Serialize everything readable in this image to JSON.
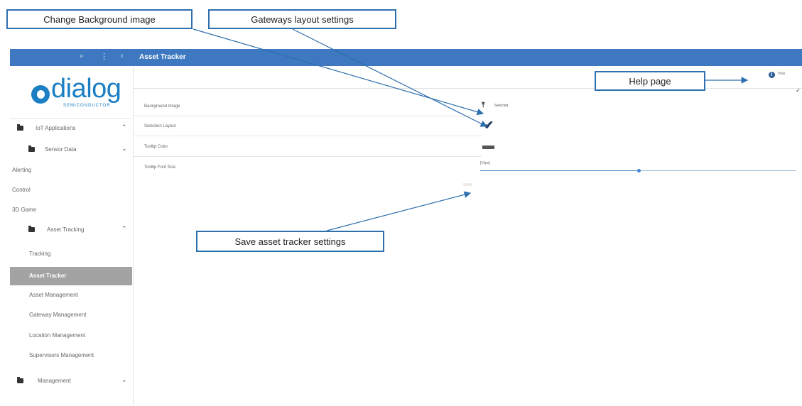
{
  "callouts": {
    "background": "Change Background image",
    "gateways": "Gateways layout settings",
    "help": "Help page",
    "save": "Save asset tracker settings"
  },
  "header": {
    "title": "Asset Tracker",
    "icons": [
      "search-icon",
      "more-vertical-icon",
      "chevron-left-icon"
    ],
    "bar_color": "#3d78c0"
  },
  "sidebar": {
    "brand": {
      "name": "dialog",
      "tagline": "SEMICONDUCTOR",
      "color": "#1c7fc4"
    },
    "items": [
      {
        "label": "IoT Applications",
        "type": "group",
        "expanded": true
      },
      {
        "label": "Sensor Data",
        "type": "group",
        "expanded": false
      },
      {
        "label": "Alerting",
        "type": "link"
      },
      {
        "label": "Control",
        "type": "link"
      },
      {
        "label": "3D Game",
        "type": "link"
      },
      {
        "label": "Asset Tracking",
        "type": "group",
        "expanded": true
      },
      {
        "label": "Tracking",
        "type": "link"
      },
      {
        "label": "Asset Tracker",
        "type": "link",
        "active": true
      },
      {
        "label": "Asset Management",
        "type": "link"
      },
      {
        "label": "Gateway Management",
        "type": "link"
      },
      {
        "label": "Location Management",
        "type": "link"
      },
      {
        "label": "Supervisors Management",
        "type": "link"
      },
      {
        "label": "Management",
        "type": "group",
        "expanded": false
      }
    ]
  },
  "main": {
    "help_label": "Help",
    "settings": [
      {
        "label": "Background Image",
        "value": "Selected"
      },
      {
        "label": "Selection Layout",
        "value": ""
      },
      {
        "label": "Tooltip Color",
        "value": ""
      },
      {
        "label": "Tooltip Font Size",
        "value": "[14px]"
      }
    ],
    "font_size_slider_fraction": 0.5,
    "save_label": "SAVE"
  }
}
